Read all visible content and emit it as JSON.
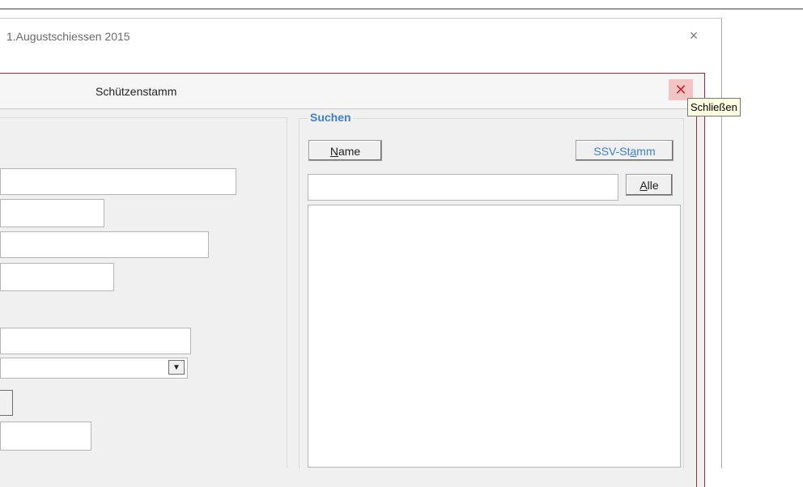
{
  "outer_window": {
    "title": "1.Augustschiessen 2015",
    "close_glyph": "×"
  },
  "dialog": {
    "title": "Schützenstamm",
    "close_glyph": "✕",
    "close_tooltip": "Schließen"
  },
  "search": {
    "legend": "Suchen",
    "name_button": {
      "prefix": "",
      "accel": "N",
      "suffix": "ame"
    },
    "ssv_button": {
      "prefix": "SSV-St",
      "accel": "a",
      "suffix": "mm"
    },
    "query_value": "",
    "alle_button": {
      "prefix": "",
      "accel": "A",
      "suffix": "lle"
    },
    "results": []
  },
  "form": {
    "combo_arrow_glyph": "▼"
  },
  "colors": {
    "dialog_border": "#9a2c3a",
    "accent_blue": "#3d7fd1",
    "close_hover": "#f2c4c4"
  }
}
